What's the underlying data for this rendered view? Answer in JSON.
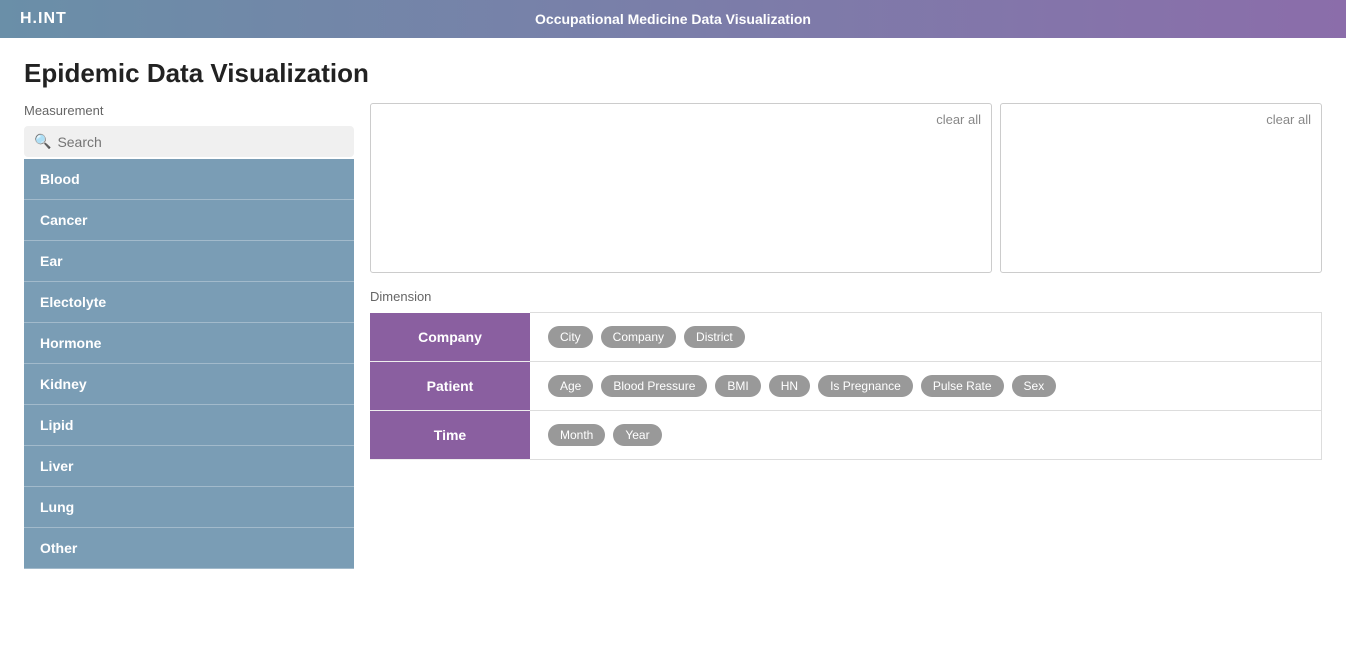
{
  "nav": {
    "logo": "H.INT",
    "title": "Occupational Medicine Data Visualization"
  },
  "page": {
    "title": "Epidemic Data Visualization"
  },
  "measurement": {
    "label": "Measurement",
    "search_placeholder": "Search",
    "items": [
      {
        "label": "Blood"
      },
      {
        "label": "Cancer"
      },
      {
        "label": "Ear"
      },
      {
        "label": "Electolyte"
      },
      {
        "label": "Hormone"
      },
      {
        "label": "Kidney"
      },
      {
        "label": "Lipid"
      },
      {
        "label": "Liver"
      },
      {
        "label": "Lung"
      },
      {
        "label": "Other"
      }
    ]
  },
  "chart": {
    "clear_all_label": "clear all",
    "clear_all_label2": "clear all"
  },
  "dimension": {
    "label": "Dimension",
    "rows": [
      {
        "category": "Company",
        "tags": [
          "City",
          "Company",
          "District"
        ]
      },
      {
        "category": "Patient",
        "tags": [
          "Age",
          "Blood Pressure",
          "BMI",
          "HN",
          "Is Pregnance",
          "Pulse Rate",
          "Sex"
        ]
      },
      {
        "category": "Time",
        "tags": [
          "Month",
          "Year"
        ]
      }
    ]
  }
}
